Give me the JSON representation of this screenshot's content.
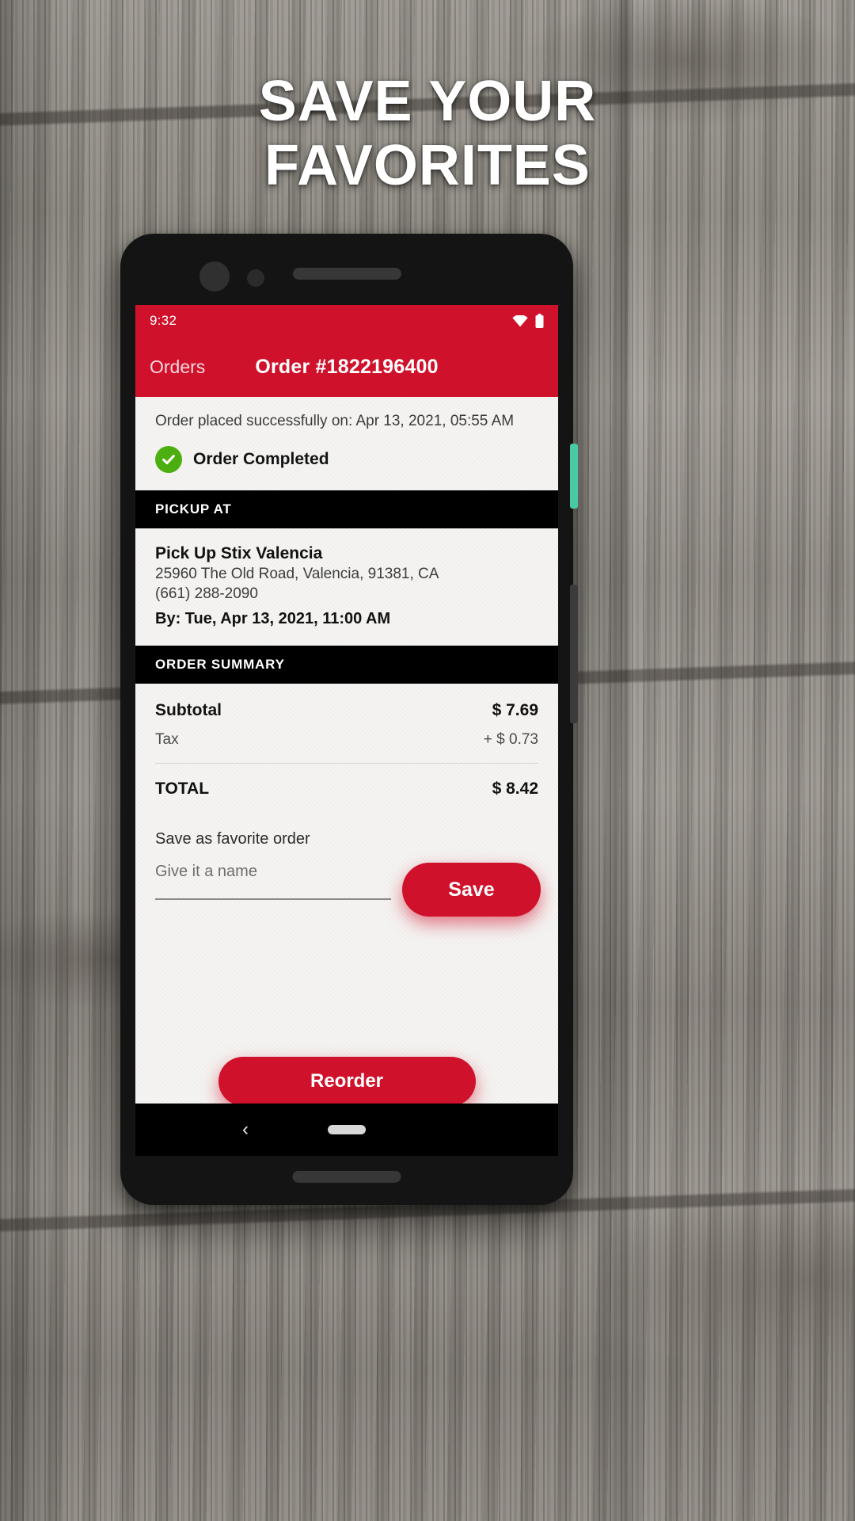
{
  "promo": {
    "headline_line1": "SAVE YOUR",
    "headline_line2": "FAVORITES"
  },
  "theme": {
    "brand_red": "#d0112b",
    "success_green": "#4caf0f",
    "section_header_bg": "#000000",
    "screen_bg": "#f6f5f3"
  },
  "status_bar": {
    "time": "9:32",
    "wifi_icon": "wifi-icon",
    "battery_icon": "battery-icon"
  },
  "app_bar": {
    "back_label": "Orders",
    "title": "Order #1822196400"
  },
  "order_status": {
    "placed_text": "Order placed successfully on: Apr 13, 2021, 05:55 AM",
    "completed_label": "Order Completed",
    "check_icon": "check-circle-icon"
  },
  "pickup": {
    "section_title": "PICKUP AT",
    "store_name": "Pick Up Stix Valencia",
    "address": "25960 The Old Road, Valencia, 91381, CA",
    "phone": "(661) 288-2090",
    "ready_by": "By: Tue, Apr 13, 2021, 11:00 AM"
  },
  "order_summary": {
    "section_title": "ORDER SUMMARY",
    "rows": [
      {
        "label": "Subtotal",
        "value": "$ 7.69"
      },
      {
        "label": "Tax",
        "value": "+ $ 0.73"
      }
    ],
    "total_label": "TOTAL",
    "total_value": "$ 8.42"
  },
  "favorite": {
    "title": "Save as favorite order",
    "input_placeholder": "Give it a name",
    "input_value": "",
    "save_label": "Save"
  },
  "actions": {
    "reorder_label": "Reorder"
  },
  "nav_bar": {
    "back_icon": "chevron-left-icon",
    "home_pill": "home-indicator"
  }
}
